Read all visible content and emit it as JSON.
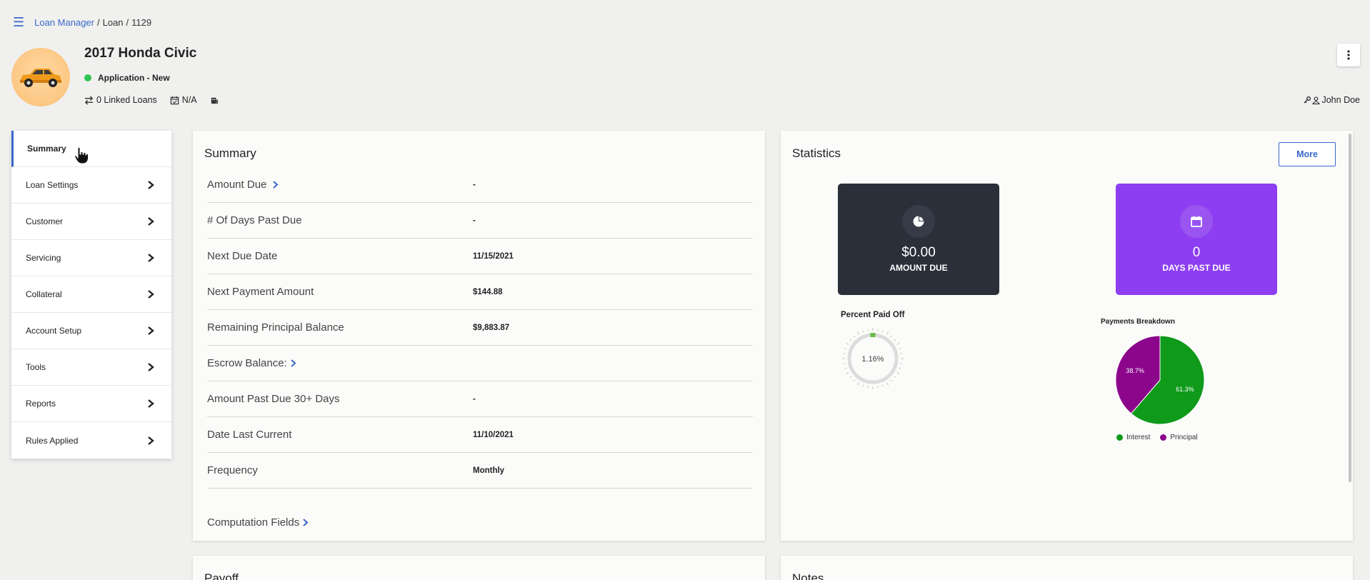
{
  "breadcrumb": {
    "root": "Loan Manager",
    "level2": "Loan",
    "id": "1129"
  },
  "loan": {
    "title": "2017 Honda Civic",
    "status": "Application - New",
    "linked_loans": "0 Linked Loans",
    "date": "N/A",
    "owner": "John Doe"
  },
  "colors": {
    "accent": "#3a68c9",
    "status_green": "#2ec455",
    "tile_dark": "#2b2f3a",
    "tile_purple": "#8d3ef2",
    "interest": "#0f9a1a",
    "principal": "#8b068b"
  },
  "sidebar": {
    "items": [
      {
        "label": "Summary"
      },
      {
        "label": "Loan Settings"
      },
      {
        "label": "Customer"
      },
      {
        "label": "Servicing"
      },
      {
        "label": "Collateral"
      },
      {
        "label": "Account Setup"
      },
      {
        "label": "Tools"
      },
      {
        "label": "Reports"
      },
      {
        "label": "Rules Applied"
      }
    ]
  },
  "summary": {
    "title": "Summary",
    "rows": [
      {
        "label": "Amount Due",
        "value": "-"
      },
      {
        "label": "# Of Days Past Due",
        "value": "-"
      },
      {
        "label": "Next Due Date",
        "value": "11/15/2021"
      },
      {
        "label": "Next Payment Amount",
        "value": "$144.88"
      },
      {
        "label": "Remaining Principal Balance",
        "value": "$9,883.87"
      },
      {
        "label": "Escrow Balance:",
        "value": ""
      },
      {
        "label": "Amount Past Due 30+ Days",
        "value": "-"
      },
      {
        "label": "Date Last Current",
        "value": "11/10/2021"
      },
      {
        "label": "Frequency",
        "value": "Monthly"
      }
    ],
    "computation_fields": "Computation Fields"
  },
  "statistics": {
    "title": "Statistics",
    "more_label": "More",
    "amount_due": {
      "value": "$0.00",
      "label": "AMOUNT DUE"
    },
    "days_past_due": {
      "value": "0",
      "label": "DAYS PAST DUE"
    },
    "percent_paid_off": {
      "title": "Percent Paid Off",
      "value": "1.16%",
      "fraction": 0.0116
    }
  },
  "chart_data": {
    "type": "pie",
    "title": "Payments Breakdown",
    "categories": [
      "Interest",
      "Principal"
    ],
    "values": [
      61.3,
      38.7
    ],
    "labels": [
      "61.3%",
      "38.7%"
    ],
    "colors": [
      "#0f9a1a",
      "#8b068b"
    ],
    "legend": "bottom"
  },
  "bottom": {
    "payoff_title": "Payoff",
    "notes_title": "Notes"
  }
}
